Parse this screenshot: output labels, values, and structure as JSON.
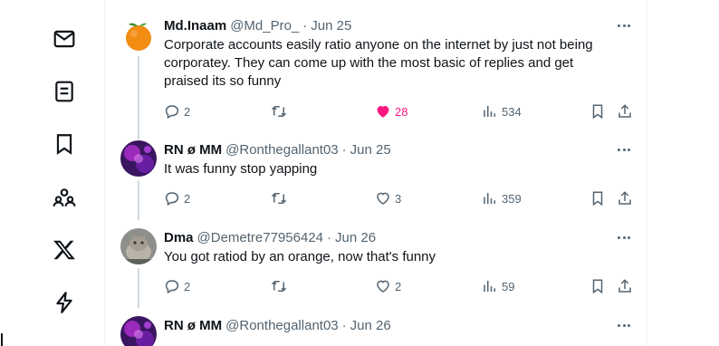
{
  "nav": {
    "items": [
      "messages",
      "lists",
      "bookmarks",
      "communities",
      "premium",
      "verified-orgs"
    ]
  },
  "tweets": [
    {
      "name": "Md.Inaam",
      "handle": "@Md_Pro_",
      "separator": "·",
      "date": "Jun 25",
      "avatar": "orange",
      "lines": [
        "Corporate accounts easily ratio anyone on the internet by just not being",
        "corporatey. They can come up with the most basic of replies and get",
        "praised its so funny"
      ],
      "replies": "2",
      "reposts": "",
      "likes": "28",
      "liked": true,
      "views": "534"
    },
    {
      "name": "RN ø MM",
      "handle": "@Ronthegallant03",
      "separator": "·",
      "date": "Jun 25",
      "avatar": "purple-abstract",
      "lines": [
        "It was funny stop yapping"
      ],
      "replies": "2",
      "reposts": "",
      "likes": "3",
      "liked": false,
      "views": "359"
    },
    {
      "name": "Dma",
      "handle": "@Demetre77956424",
      "separator": "·",
      "date": "Jun 26",
      "avatar": "cat-photo",
      "lines": [
        "You got ratiod by an orange, now that's funny"
      ],
      "replies": "2",
      "reposts": "",
      "likes": "2",
      "liked": false,
      "views": "59"
    },
    {
      "name": "RN ø MM",
      "handle": "@Ronthegallant03",
      "separator": "·",
      "date": "Jun 26",
      "avatar": "purple-abstract"
    }
  ],
  "colors": {
    "text": "#0f1419",
    "secondary": "#536471",
    "like": "#f91880",
    "thread_line": "#cfd9de",
    "border": "#eff3f4"
  }
}
